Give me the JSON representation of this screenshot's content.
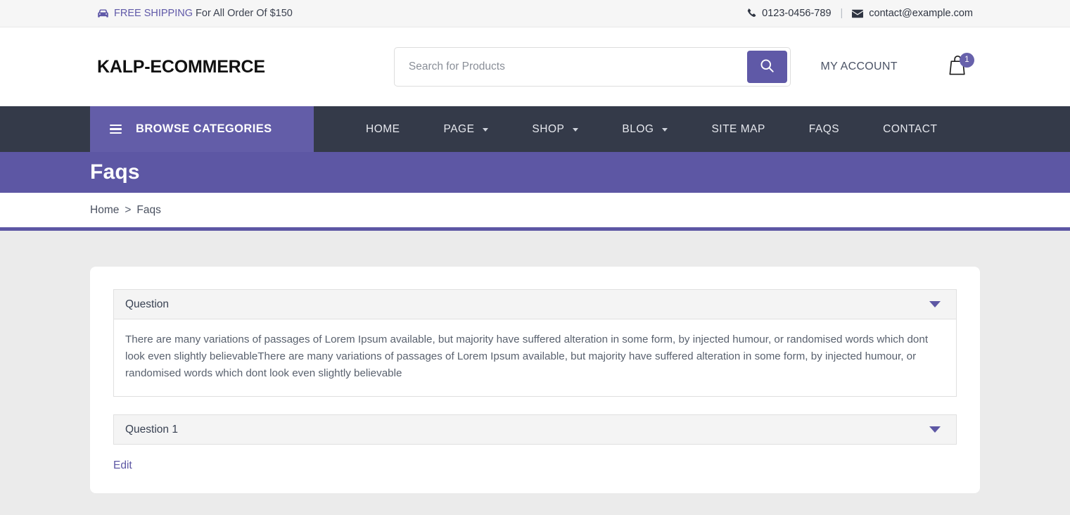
{
  "topbar": {
    "shipping_icon": "car-icon",
    "shipping_highlight": "FREE SHIPPING",
    "shipping_rest": " For All Order Of $150",
    "phone_icon": "phone-icon",
    "phone": "0123-0456-789",
    "separator": "|",
    "email_icon": "envelope-icon",
    "email": "contact@example.com"
  },
  "header": {
    "logo": "KALP-ECOMMERCE",
    "search": {
      "placeholder": "Search for Products",
      "value": "",
      "button_icon": "search-icon"
    },
    "account_label": "MY ACCOUNT",
    "cart": {
      "icon": "shopping-bag-icon",
      "count": "1"
    }
  },
  "nav": {
    "browse_label": "BROWSE CATEGORIES",
    "browse_icon": "hamburger-icon",
    "items": [
      {
        "label": "HOME",
        "has_dropdown": false
      },
      {
        "label": "PAGE",
        "has_dropdown": true
      },
      {
        "label": "SHOP",
        "has_dropdown": true
      },
      {
        "label": "BLOG",
        "has_dropdown": true
      },
      {
        "label": "SITE MAP",
        "has_dropdown": false
      },
      {
        "label": "FAQS",
        "has_dropdown": false
      },
      {
        "label": "CONTACT",
        "has_dropdown": false
      }
    ]
  },
  "banner": {
    "title": "Faqs"
  },
  "breadcrumb": {
    "home": "Home",
    "separator": ">",
    "current": "Faqs"
  },
  "faq": {
    "items": [
      {
        "question": "Question",
        "caret_icon": "caret-down-icon",
        "expanded": true,
        "answer": "There are many variations of passages of Lorem Ipsum available, but majority have suffered alteration in some form, by injected humour, or randomised words which dont look even slightly believableThere are many variations of passages of Lorem Ipsum available, but majority have suffered alteration in some form, by injected humour, or randomised words which dont look even slightly believable"
      },
      {
        "question": "Question 1",
        "caret_icon": "caret-down-icon",
        "expanded": false,
        "answer": ""
      }
    ],
    "edit_label": "Edit"
  },
  "colors": {
    "accent_purple": "#5d57a4",
    "browse_purple": "#635da8",
    "nav_dark": "#343a49",
    "badge_purple": "#6761ab",
    "page_bg": "#ebebeb",
    "topbar_bg": "#f6f6f6"
  }
}
